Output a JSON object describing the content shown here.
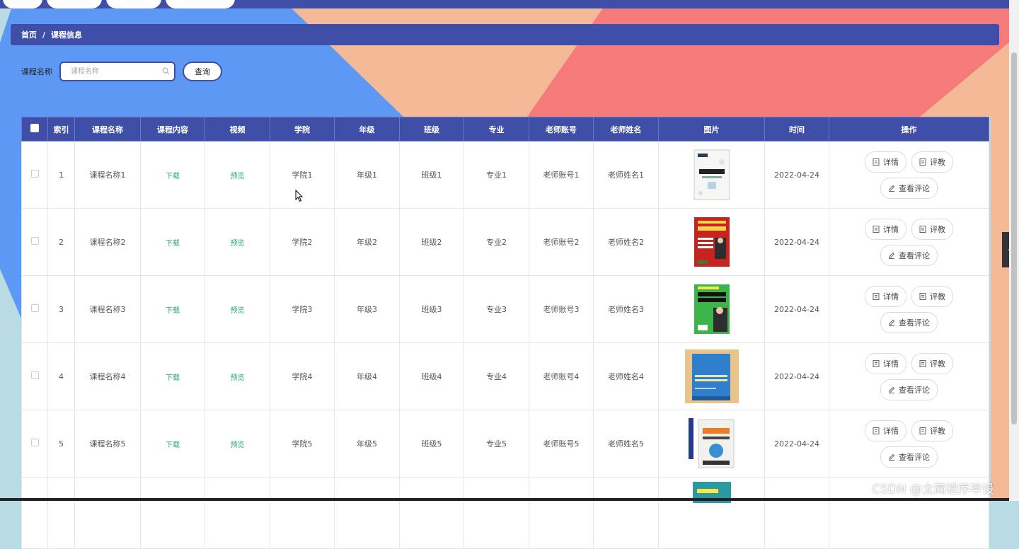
{
  "breadcrumb": {
    "home": "首页",
    "separator": "/",
    "current": "课程信息"
  },
  "search": {
    "label": "课程名称",
    "placeholder": "课程名称",
    "button": "查询"
  },
  "table": {
    "headers": [
      "索引",
      "课程名称",
      "课程内容",
      "视频",
      "学院",
      "年级",
      "班级",
      "专业",
      "老师账号",
      "老师姓名",
      "图片",
      "时间",
      "操作"
    ],
    "rows": [
      {
        "index": "1",
        "name": "课程名称1",
        "content": "下载",
        "video": "预览",
        "college": "学院1",
        "grade": "年级1",
        "class": "班级1",
        "major": "专业1",
        "teacher_account": "老师账号1",
        "teacher_name": "老师姓名1",
        "image": "book-cover-1",
        "date": "2022-04-24"
      },
      {
        "index": "2",
        "name": "课程名称2",
        "content": "下载",
        "video": "预览",
        "college": "学院2",
        "grade": "年级2",
        "class": "班级2",
        "major": "专业2",
        "teacher_account": "老师账号2",
        "teacher_name": "老师姓名2",
        "image": "book-cover-2",
        "date": "2022-04-24"
      },
      {
        "index": "3",
        "name": "课程名称3",
        "content": "下载",
        "video": "预览",
        "college": "学院3",
        "grade": "年级3",
        "class": "班级3",
        "major": "专业3",
        "teacher_account": "老师账号3",
        "teacher_name": "老师姓名3",
        "image": "book-cover-3",
        "date": "2022-04-24"
      },
      {
        "index": "4",
        "name": "课程名称4",
        "content": "下载",
        "video": "预览",
        "college": "学院4",
        "grade": "年级4",
        "class": "班级4",
        "major": "专业4",
        "teacher_account": "老师账号4",
        "teacher_name": "老师姓名4",
        "image": "book-cover-4",
        "date": "2022-04-24"
      },
      {
        "index": "5",
        "name": "课程名称5",
        "content": "下载",
        "video": "预览",
        "college": "学院5",
        "grade": "年级5",
        "class": "班级5",
        "major": "专业5",
        "teacher_account": "老师账号5",
        "teacher_name": "老师姓名5",
        "image": "book-cover-5",
        "date": "2022-04-24"
      }
    ],
    "actions": {
      "detail": "详情",
      "evaluate": "评教",
      "view_comments": "查看评论"
    }
  },
  "watermark": "CSDN @太简程序毕设",
  "colors": {
    "primary": "#3f4fa8",
    "link": "#2aa877",
    "bg_blue": "#5d98f4",
    "bg_peach": "#f4b997",
    "bg_coral": "#f57a7a",
    "bg_teal": "#b9dbe3"
  },
  "icons": {
    "search": "search-icon",
    "detail": "document-icon",
    "evaluate": "document-icon",
    "comments": "edit-icon",
    "side_toggle": "chevron-left-icon"
  }
}
